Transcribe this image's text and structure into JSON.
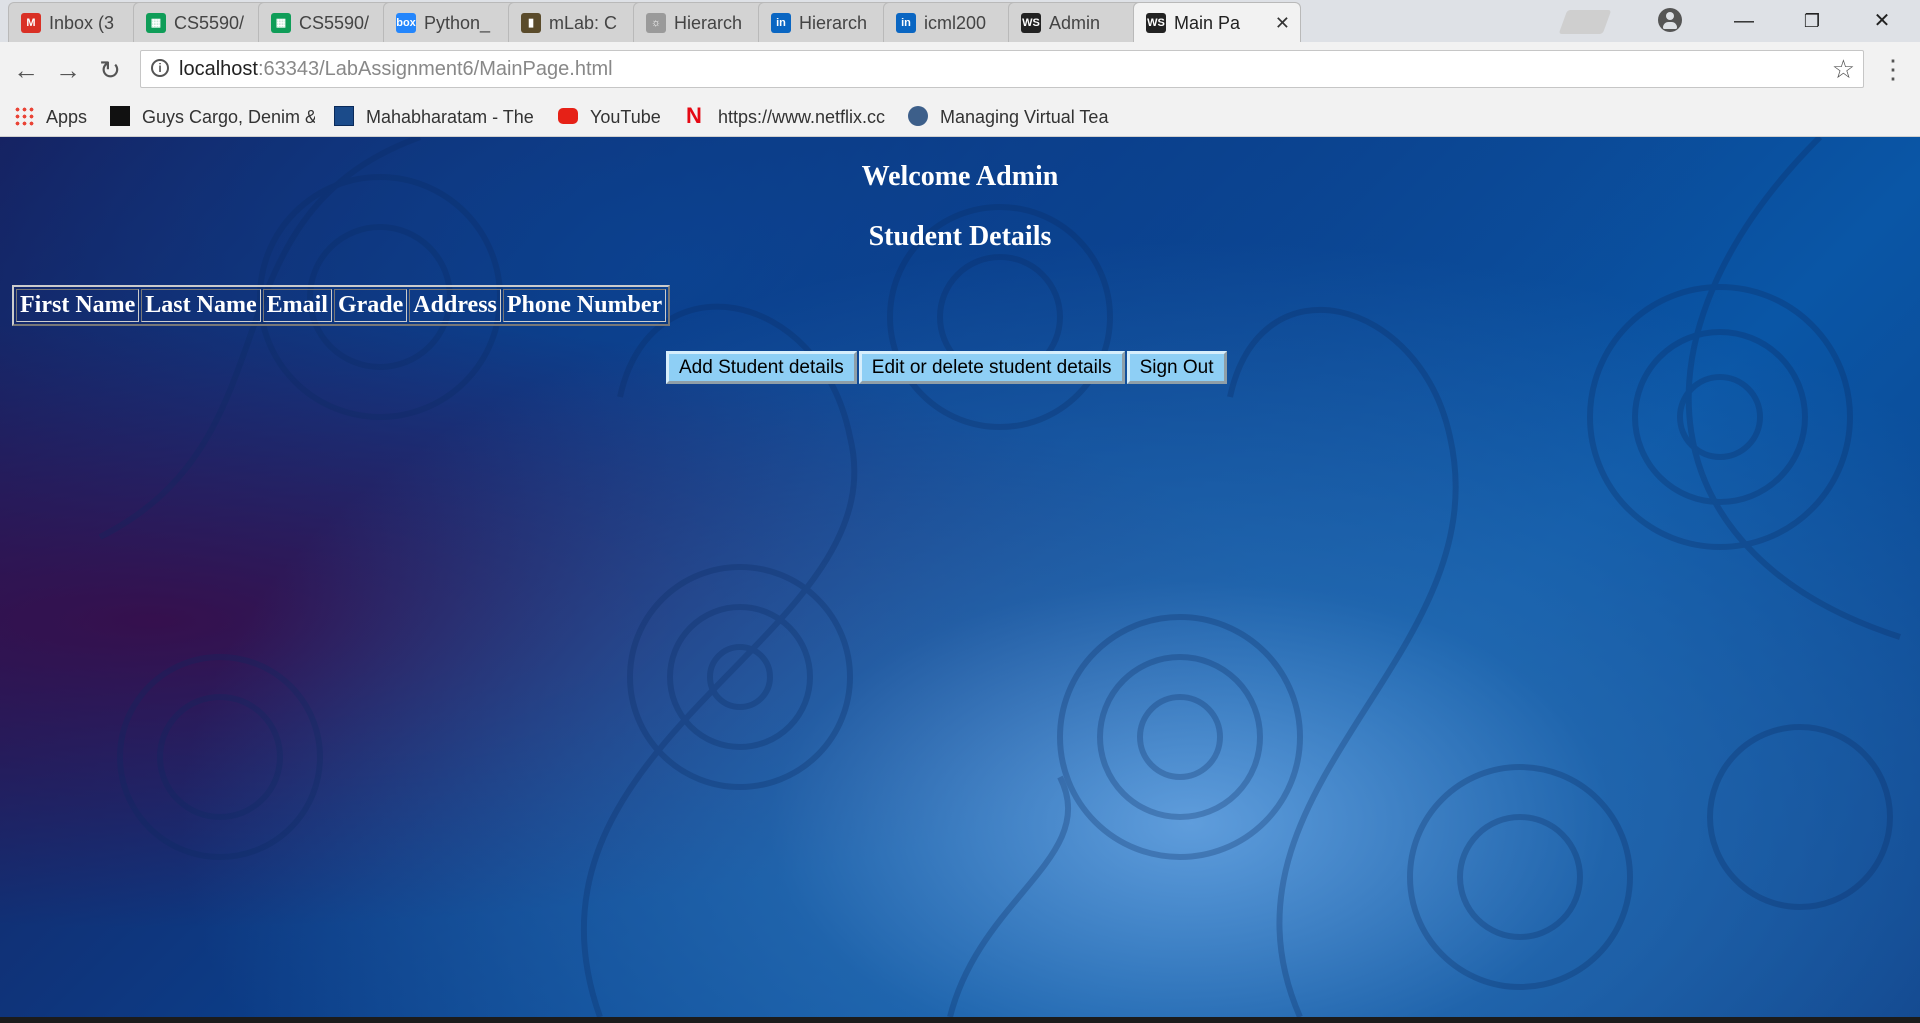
{
  "browser": {
    "tabs": [
      {
        "label": "Inbox (3",
        "icon": "gmail-icon",
        "color": "#d93025",
        "glyph": "M"
      },
      {
        "label": "CS5590/",
        "icon": "sheets-icon",
        "color": "#0f9d58",
        "glyph": "▦"
      },
      {
        "label": "CS5590/",
        "icon": "sheets-icon",
        "color": "#0f9d58",
        "glyph": "▦"
      },
      {
        "label": "Python_",
        "icon": "box-icon",
        "color": "#2486fc",
        "glyph": "box"
      },
      {
        "label": "mLab: C",
        "icon": "mlab-icon",
        "color": "#5a4b2b",
        "glyph": "▮"
      },
      {
        "label": "Hierarch",
        "icon": "lightbulb-icon",
        "color": "#9a9a9a",
        "glyph": "☼"
      },
      {
        "label": "Hierarch",
        "icon": "linkedin-icon",
        "color": "#0a66c2",
        "glyph": "in"
      },
      {
        "label": "icml200",
        "icon": "linkedin-icon",
        "color": "#0a66c2",
        "glyph": "in"
      },
      {
        "label": "Admin",
        "icon": "webstorm-icon",
        "color": "#222222",
        "glyph": "WS"
      },
      {
        "label": "Main Pa",
        "icon": "webstorm-icon",
        "color": "#222222",
        "glyph": "WS",
        "active": true
      }
    ],
    "tab_close": "✕",
    "window_controls": {
      "minimize": "—",
      "restore": "❐",
      "close": "✕"
    },
    "nav": {
      "back": "←",
      "forward": "→",
      "reload": "↻"
    },
    "address": {
      "host": "localhost",
      "rest": ":63343/LabAssignment6/MainPage.html",
      "info_glyph": "i"
    },
    "star": "☆",
    "menu": "⋮",
    "bookmarks": [
      {
        "label": "Apps",
        "icon": "apps-grid-icon"
      },
      {
        "label": "Guys Cargo, Denim &",
        "icon": "guys-cargo-icon"
      },
      {
        "label": "Mahabharatam - The",
        "icon": "mahabharatam-icon"
      },
      {
        "label": "YouTube",
        "icon": "youtube-icon"
      },
      {
        "label": "https://www.netflix.cc",
        "icon": "netflix-icon"
      },
      {
        "label": "Managing Virtual Tea",
        "icon": "e-circle-icon"
      }
    ]
  },
  "page": {
    "welcome": "Welcome Admin",
    "heading": "Student Details",
    "table_headers": [
      "First Name",
      "Last Name",
      "Email",
      "Grade",
      "Address",
      "Phone Number"
    ],
    "buttons": {
      "add": "Add Student details",
      "edit": "Edit or delete student details",
      "signout": "Sign Out"
    },
    "colors": {
      "button_bg": "#8ecff5",
      "heading_text": "#ffffff"
    }
  }
}
